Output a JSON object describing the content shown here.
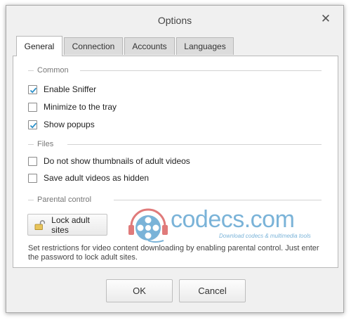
{
  "window": {
    "title": "Options"
  },
  "tabs": [
    {
      "label": "General",
      "active": true
    },
    {
      "label": "Connection",
      "active": false
    },
    {
      "label": "Accounts",
      "active": false
    },
    {
      "label": "Languages",
      "active": false
    }
  ],
  "groups": {
    "common": {
      "label": "Common",
      "items": [
        {
          "label": "Enable Sniffer",
          "checked": true
        },
        {
          "label": "Minimize to the tray",
          "checked": false
        },
        {
          "label": "Show popups",
          "checked": true
        }
      ]
    },
    "files": {
      "label": "Files",
      "items": [
        {
          "label": "Do not show thumbnails of adult videos",
          "checked": false
        },
        {
          "label": "Save adult videos as hidden",
          "checked": false
        }
      ]
    },
    "parental": {
      "label": "Parental control",
      "lock_button": "Lock adult sites",
      "description": "Set restrictions for video content downloading by enabling parental control. Just enter the password to lock adult sites."
    }
  },
  "watermark": {
    "text": "codecs.com",
    "subtitle": "Download codecs & multimedia tools"
  },
  "footer": {
    "ok_label": "OK",
    "cancel_label": "Cancel"
  },
  "colors": {
    "checkmark": "#2a8fc7",
    "watermark": "#7ab3d8",
    "watermark_accent": "#e07a7a"
  },
  "icons": {
    "close": "close-icon",
    "lock": "lock-icon",
    "check": "checkmark-icon"
  }
}
